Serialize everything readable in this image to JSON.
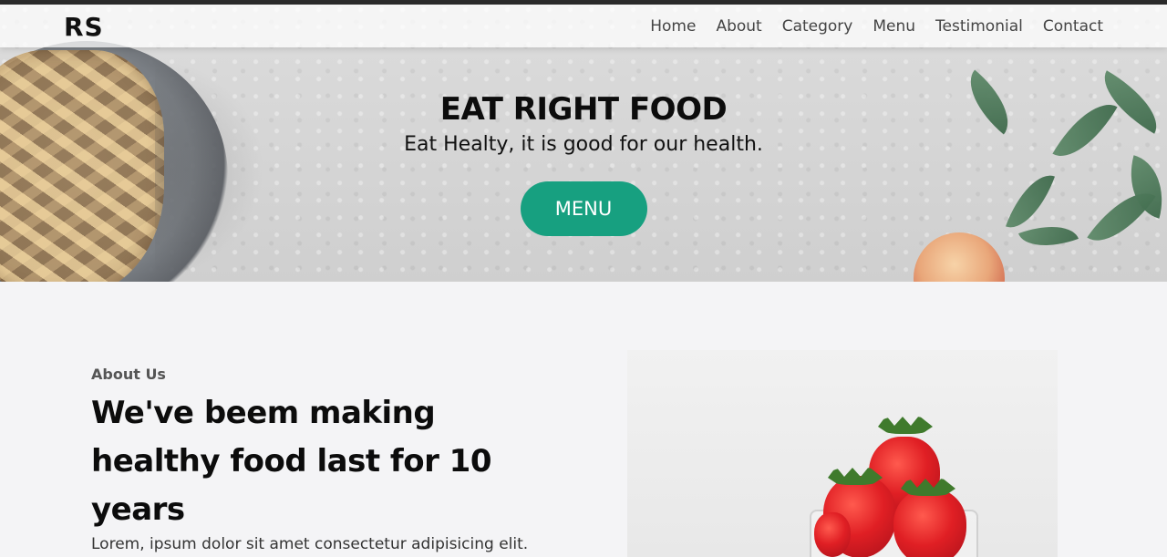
{
  "brand": {
    "logo_text": "RS"
  },
  "nav": {
    "items": [
      {
        "label": "Home"
      },
      {
        "label": "About"
      },
      {
        "label": "Category"
      },
      {
        "label": "Menu"
      },
      {
        "label": "Testimonial"
      },
      {
        "label": "Contact"
      }
    ]
  },
  "hero": {
    "title": "EAT RIGHT FOOD",
    "subtitle": "Eat Healty, it is good for our health.",
    "button_label": "MENU"
  },
  "about": {
    "label": "About Us",
    "heading": "We've beem making healthy food last for 10 years",
    "text": "Lorem, ipsum dolor sit amet consectetur adipisicing elit."
  },
  "colors": {
    "accent": "#17a080",
    "top_bar": "#2b2b2b",
    "page_background": "#f4f4f6"
  },
  "icons": {
    "hero_left_image": "pie-image",
    "hero_right_image": "leaves-apple-image",
    "about_image": "strawberries-image"
  }
}
